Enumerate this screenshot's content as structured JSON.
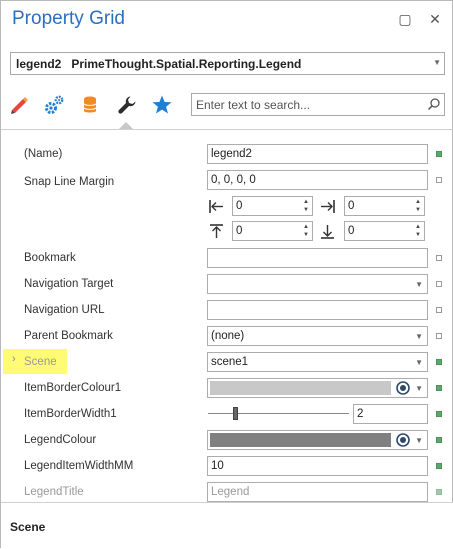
{
  "window": {
    "title": "Property Grid",
    "restore_glyph": "▢",
    "close_glyph": "✕"
  },
  "object_selector": {
    "name": "legend2",
    "type": "PrimeThought.Spatial.Reporting.Legend"
  },
  "toolbar": {
    "tabs": [
      "pen-icon",
      "gears-icon",
      "database-icon",
      "wrench-icon",
      "star-icon"
    ],
    "active_tab": "wrench-icon"
  },
  "search": {
    "placeholder": "Enter text to search..."
  },
  "properties": {
    "name": {
      "label": "(Name)",
      "value": "legend2"
    },
    "snap_line_margin": {
      "label": "Snap Line Margin",
      "value": "0, 0, 0, 0",
      "left": "0",
      "right": "0",
      "top": "0",
      "bottom": "0"
    },
    "bookmark": {
      "label": "Bookmark",
      "value": ""
    },
    "navigation_target": {
      "label": "Navigation Target",
      "value": ""
    },
    "navigation_url": {
      "label": "Navigation URL",
      "value": ""
    },
    "parent_bookmark": {
      "label": "Parent Bookmark",
      "value": "(none)"
    },
    "scene": {
      "label": "Scene",
      "value": "scene1"
    },
    "item_border_colour": {
      "label": "ItemBorderColour1",
      "color": "#c8c8c8"
    },
    "item_border_width": {
      "label": "ItemBorderWidth1",
      "value": "2",
      "slider_fraction": 0.2
    },
    "legend_colour": {
      "label": "LegendColour",
      "color": "#808080"
    },
    "legend_item_width": {
      "label": "LegendItemWidthMM",
      "value": "10"
    },
    "legend_title": {
      "label": "LegendTitle",
      "value": "Legend"
    }
  },
  "description": {
    "title": "Scene"
  },
  "colors": {
    "title": "#2b6fc1",
    "highlight": "#fffb74",
    "modified": "#5ba96a"
  }
}
